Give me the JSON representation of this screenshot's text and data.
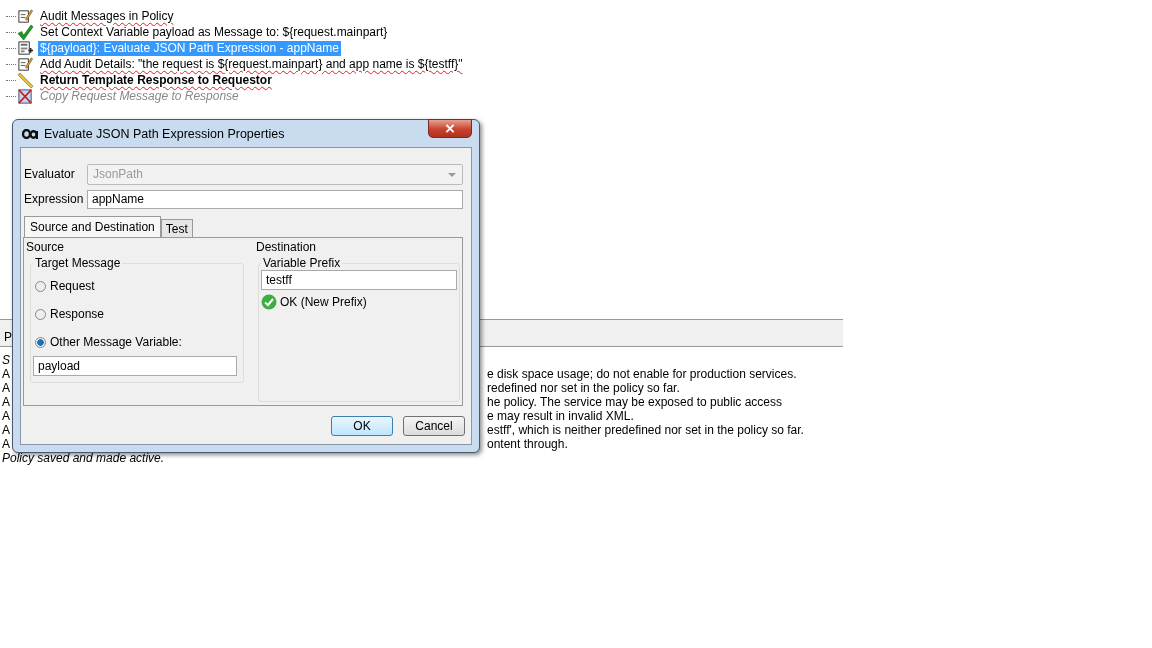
{
  "policy_tree": [
    {
      "label": "Audit Messages in Policy",
      "kind": "audit",
      "selected": false,
      "disabled": false,
      "flagged": true
    },
    {
      "label": "Set Context Variable payload as Message to: ${request.mainpart}",
      "kind": "check",
      "selected": false,
      "disabled": false,
      "flagged": false
    },
    {
      "label": "${payload}: Evaluate JSON Path Expression - appName",
      "kind": "jsonpath",
      "selected": true,
      "disabled": false,
      "flagged": false
    },
    {
      "label": "Add Audit Details: \"the request is ${request.mainpart} and app name is ${testff}\"",
      "kind": "audit",
      "selected": false,
      "disabled": false,
      "flagged": true
    },
    {
      "label": "Return Template Response to Requestor",
      "kind": "template",
      "selected": false,
      "disabled": false,
      "flagged": true
    },
    {
      "label": "Copy Request Message to Response",
      "kind": "disabled",
      "selected": false,
      "disabled": true,
      "flagged": false
    }
  ],
  "messages_panel": {
    "tab": "P",
    "lines": [
      {
        "left": "S",
        "italic": true
      },
      {
        "left": "A",
        "right": "e disk space usage; do not enable for production services.",
        "italic": false
      },
      {
        "left": "A",
        "right": "redefined nor set in the policy so far.",
        "italic": false
      },
      {
        "left": "A",
        "right": "he policy. The service may be exposed to public access",
        "italic": false
      },
      {
        "left": "A",
        "right": "e may result in invalid XML.",
        "italic": false
      },
      {
        "left": "A",
        "right": "estff', which is neither predefined nor set in the policy so far.",
        "italic": false
      },
      {
        "left": "A",
        "right": "ontent through.",
        "italic": false
      },
      {
        "left": "Policy saved and made active.",
        "italic": true
      }
    ]
  },
  "dialog": {
    "title": "Evaluate JSON Path Expression Properties",
    "evaluator": {
      "label": "Evaluator",
      "value": "JsonPath",
      "disabled": true
    },
    "expression": {
      "label": "Expression",
      "value": "appName"
    },
    "tabs": [
      {
        "label": "Source and Destination",
        "selected": true
      },
      {
        "label": "Test",
        "selected": false
      }
    ],
    "source": {
      "heading": "Source",
      "group": "Target Message",
      "options": [
        {
          "label": "Request",
          "selected": false
        },
        {
          "label": "Response",
          "selected": false
        },
        {
          "label": "Other Message Variable:",
          "selected": true
        }
      ],
      "variable": "payload"
    },
    "destination": {
      "heading": "Destination",
      "group": "Variable Prefix",
      "value": "testff",
      "status": "OK (New Prefix)"
    },
    "buttons": [
      {
        "label": "OK",
        "default": true
      },
      {
        "label": "Cancel",
        "default": false
      }
    ]
  }
}
